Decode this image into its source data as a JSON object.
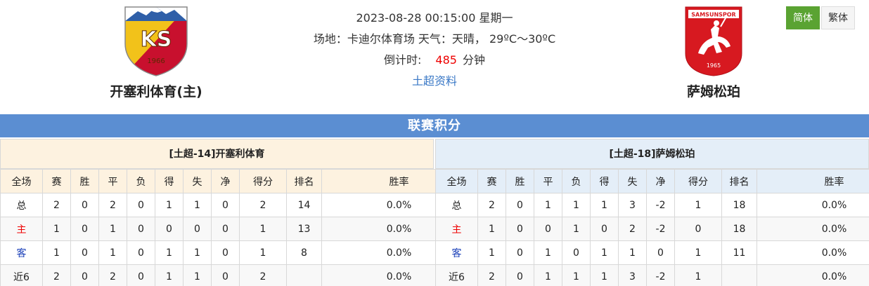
{
  "match": {
    "datetime": "2023-08-28 00:15:00 星期一",
    "venue_line": "场地：卡迪尔体育场 天气：天晴， 29ºC～30ºC",
    "countdown_label": "倒计时:",
    "countdown_value": "485",
    "countdown_unit": "分钟",
    "league_link": "土超资料"
  },
  "home_team": {
    "name": "开塞利体育(主)",
    "logo_text": "KS",
    "logo_year": "1966"
  },
  "away_team": {
    "name": "萨姆松珀",
    "logo_text": "SAMSUNSPOR",
    "logo_year": "1965"
  },
  "language": {
    "simplified": "简体",
    "traditional": "繁体"
  },
  "section_title": "联赛积分",
  "columns": [
    "全场",
    "赛",
    "胜",
    "平",
    "负",
    "得",
    "失",
    "净",
    "得分",
    "排名",
    "胜率"
  ],
  "home_panel": {
    "title": "[土超-14]开塞利体育",
    "rows": [
      [
        "总",
        "2",
        "0",
        "2",
        "0",
        "1",
        "1",
        "0",
        "2",
        "14",
        "0.0%"
      ],
      [
        "主",
        "1",
        "0",
        "1",
        "0",
        "0",
        "0",
        "0",
        "1",
        "13",
        "0.0%"
      ],
      [
        "客",
        "1",
        "0",
        "1",
        "0",
        "1",
        "1",
        "0",
        "1",
        "8",
        "0.0%"
      ],
      [
        "近6",
        "2",
        "0",
        "2",
        "0",
        "1",
        "1",
        "0",
        "2",
        "",
        "0.0%"
      ]
    ]
  },
  "away_panel": {
    "title": "[土超-18]萨姆松珀",
    "rows": [
      [
        "总",
        "2",
        "0",
        "1",
        "1",
        "1",
        "3",
        "-2",
        "1",
        "18",
        "0.0%"
      ],
      [
        "主",
        "1",
        "0",
        "0",
        "1",
        "0",
        "2",
        "-2",
        "0",
        "18",
        "0.0%"
      ],
      [
        "客",
        "1",
        "0",
        "1",
        "0",
        "1",
        "1",
        "0",
        "1",
        "11",
        "0.0%"
      ],
      [
        "近6",
        "2",
        "0",
        "1",
        "1",
        "1",
        "3",
        "-2",
        "1",
        "",
        "0.0%"
      ]
    ]
  },
  "colors": {
    "section_bar": "#5b8ed2",
    "active_lang": "#5aa332",
    "countdown": "#ee0000",
    "link": "#3a78c6",
    "home_label": "#ee0000",
    "away_label": "#1a3fb8"
  },
  "icons": {
    "home_logo": "kayserispor-crest-icon",
    "away_logo": "samsunspor-crest-icon"
  }
}
